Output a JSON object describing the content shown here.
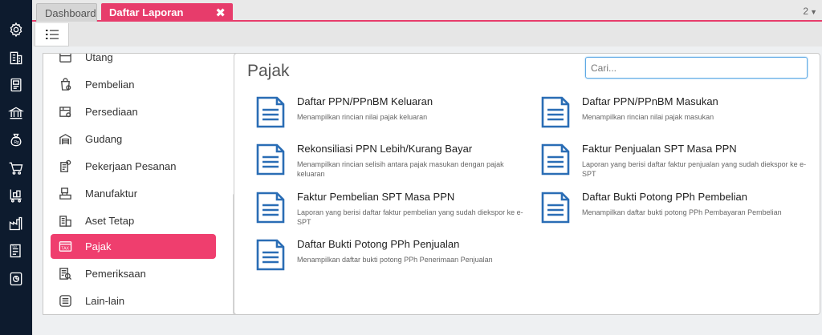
{
  "rail": {
    "icons": [
      "gear-icon",
      "building-icon",
      "ledger-icon",
      "bank-icon",
      "money-bag-icon",
      "cart-icon",
      "trolley-icon",
      "factory-icon",
      "tax-icon",
      "report-icon"
    ]
  },
  "tabs": {
    "dashboard_label": "Dashboard",
    "active_label": "Daftar Laporan",
    "close_glyph": "✖",
    "count": "2"
  },
  "menu": {
    "items": [
      {
        "label": "Utang",
        "icon": "debt-icon"
      },
      {
        "label": "Pembelian",
        "icon": "purchase-icon"
      },
      {
        "label": "Persediaan",
        "icon": "inventory-icon"
      },
      {
        "label": "Gudang",
        "icon": "warehouse-icon"
      },
      {
        "label": "Pekerjaan Pesanan",
        "icon": "job-order-icon"
      },
      {
        "label": "Manufaktur",
        "icon": "manufacturing-icon"
      },
      {
        "label": "Aset Tetap",
        "icon": "fixed-asset-icon"
      },
      {
        "label": "Pajak",
        "icon": "tax-icon",
        "active": true
      },
      {
        "label": "Pemeriksaan",
        "icon": "audit-icon"
      },
      {
        "label": "Lain-lain",
        "icon": "other-icon"
      }
    ]
  },
  "panel": {
    "title": "Pajak",
    "search_placeholder": "Cari...",
    "reports": [
      {
        "title": "Daftar PPN/PPnBM Keluaran",
        "desc": "Menampilkan rincian nilai pajak keluaran"
      },
      {
        "title": "Daftar PPN/PPnBM Masukan",
        "desc": "Menampilkan rincian nilai pajak masukan"
      },
      {
        "title": "Rekonsiliasi PPN Lebih/Kurang Bayar",
        "desc": "Menampilkan rincian selisih antara pajak masukan dengan pajak keluaran"
      },
      {
        "title": "Faktur Penjualan SPT Masa PPN",
        "desc": "Laporan yang berisi daftar faktur penjualan yang sudah diekspor ke e-SPT"
      },
      {
        "title": "Faktur Pembelian SPT Masa PPN",
        "desc": "Laporan yang berisi daftar faktur pembelian yang sudah diekspor ke e-SPT"
      },
      {
        "title": "Daftar Bukti Potong PPh Pembelian",
        "desc": "Menampilkan daftar bukti potong PPh Pembayaran Pembelian"
      },
      {
        "title": "Daftar Bukti Potong PPh Penjualan",
        "desc": "Menampilkan daftar bukti potong PPh Penerimaan Penjualan"
      }
    ]
  },
  "colors": {
    "accent": "#e73c6b",
    "rail": "#0d1b2e",
    "doc_icon": "#2a6db5"
  }
}
